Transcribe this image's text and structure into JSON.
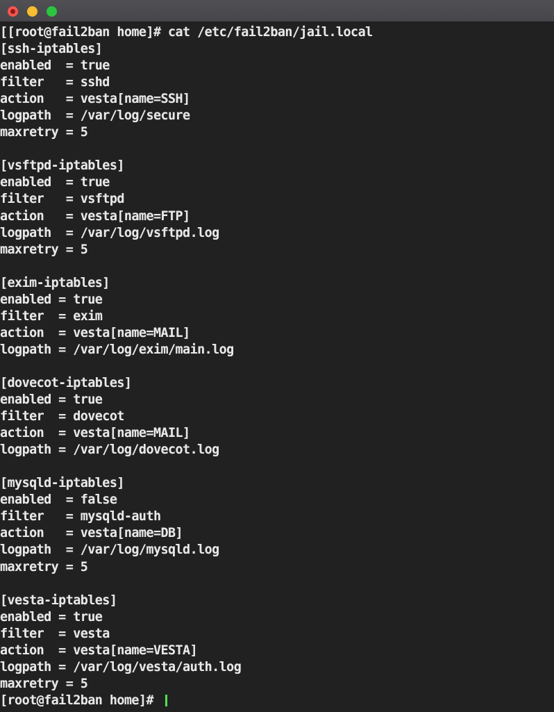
{
  "window": {
    "titlebar": {
      "buttons": [
        {
          "name": "close-button",
          "label": "close",
          "color": "#f5564f"
        },
        {
          "name": "minimize-button",
          "label": "minimize",
          "color": "#f6bd2f"
        },
        {
          "name": "maximize-button",
          "label": "maximize",
          "color": "#2ac63f"
        }
      ]
    }
  },
  "theme": {
    "titlebar_bg": "#47464a",
    "terminal_bg": "#212121",
    "text_color": "#e8e8e8",
    "cursor_color": "#4ee44e"
  },
  "terminal": {
    "prompt": "[root@fail2ban home]#",
    "command": "cat /etc/fail2ban/jail.local",
    "file_path": "/etc/fail2ban/jail.local",
    "cursor_visible": true,
    "lines": [
      "[[root@fail2ban home]# cat /etc/fail2ban/jail.local",
      "[ssh-iptables]",
      "enabled  = true",
      "filter   = sshd",
      "action   = vesta[name=SSH]",
      "logpath  = /var/log/secure",
      "maxretry = 5",
      "",
      "[vsftpd-iptables]",
      "enabled  = true",
      "filter   = vsftpd",
      "action   = vesta[name=FTP]",
      "logpath  = /var/log/vsftpd.log",
      "maxretry = 5",
      "",
      "[exim-iptables]",
      "enabled = true",
      "filter  = exim",
      "action  = vesta[name=MAIL]",
      "logpath = /var/log/exim/main.log",
      "",
      "[dovecot-iptables]",
      "enabled = true",
      "filter  = dovecot",
      "action  = vesta[name=MAIL]",
      "logpath = /var/log/dovecot.log",
      "",
      "[mysqld-iptables]",
      "enabled  = false",
      "filter   = mysqld-auth",
      "action   = vesta[name=DB]",
      "logpath  = /var/log/mysqld.log",
      "maxretry = 5",
      "",
      "[vesta-iptables]",
      "enabled = true",
      "filter  = vesta",
      "action  = vesta[name=VESTA]",
      "logpath = /var/log/vesta/auth.log",
      "maxretry = 5"
    ],
    "final_prompt": "[root@fail2ban home]# ",
    "jails": [
      {
        "section": "[ssh-iptables]",
        "enabled": "true",
        "filter": "sshd",
        "action": "vesta[name=SSH]",
        "logpath": "/var/log/secure",
        "maxretry": "5"
      },
      {
        "section": "[vsftpd-iptables]",
        "enabled": "true",
        "filter": "vsftpd",
        "action": "vesta[name=FTP]",
        "logpath": "/var/log/vsftpd.log",
        "maxretry": "5"
      },
      {
        "section": "[exim-iptables]",
        "enabled": "true",
        "filter": "exim",
        "action": "vesta[name=MAIL]",
        "logpath": "/var/log/exim/main.log",
        "maxretry": null
      },
      {
        "section": "[dovecot-iptables]",
        "enabled": "true",
        "filter": "dovecot",
        "action": "vesta[name=MAIL]",
        "logpath": "/var/log/dovecot.log",
        "maxretry": null
      },
      {
        "section": "[mysqld-iptables]",
        "enabled": "false",
        "filter": "mysqld-auth",
        "action": "vesta[name=DB]",
        "logpath": "/var/log/mysqld.log",
        "maxretry": "5"
      },
      {
        "section": "[vesta-iptables]",
        "enabled": "true",
        "filter": "vesta",
        "action": "vesta[name=VESTA]",
        "logpath": "/var/log/vesta/auth.log",
        "maxretry": "5"
      }
    ]
  }
}
